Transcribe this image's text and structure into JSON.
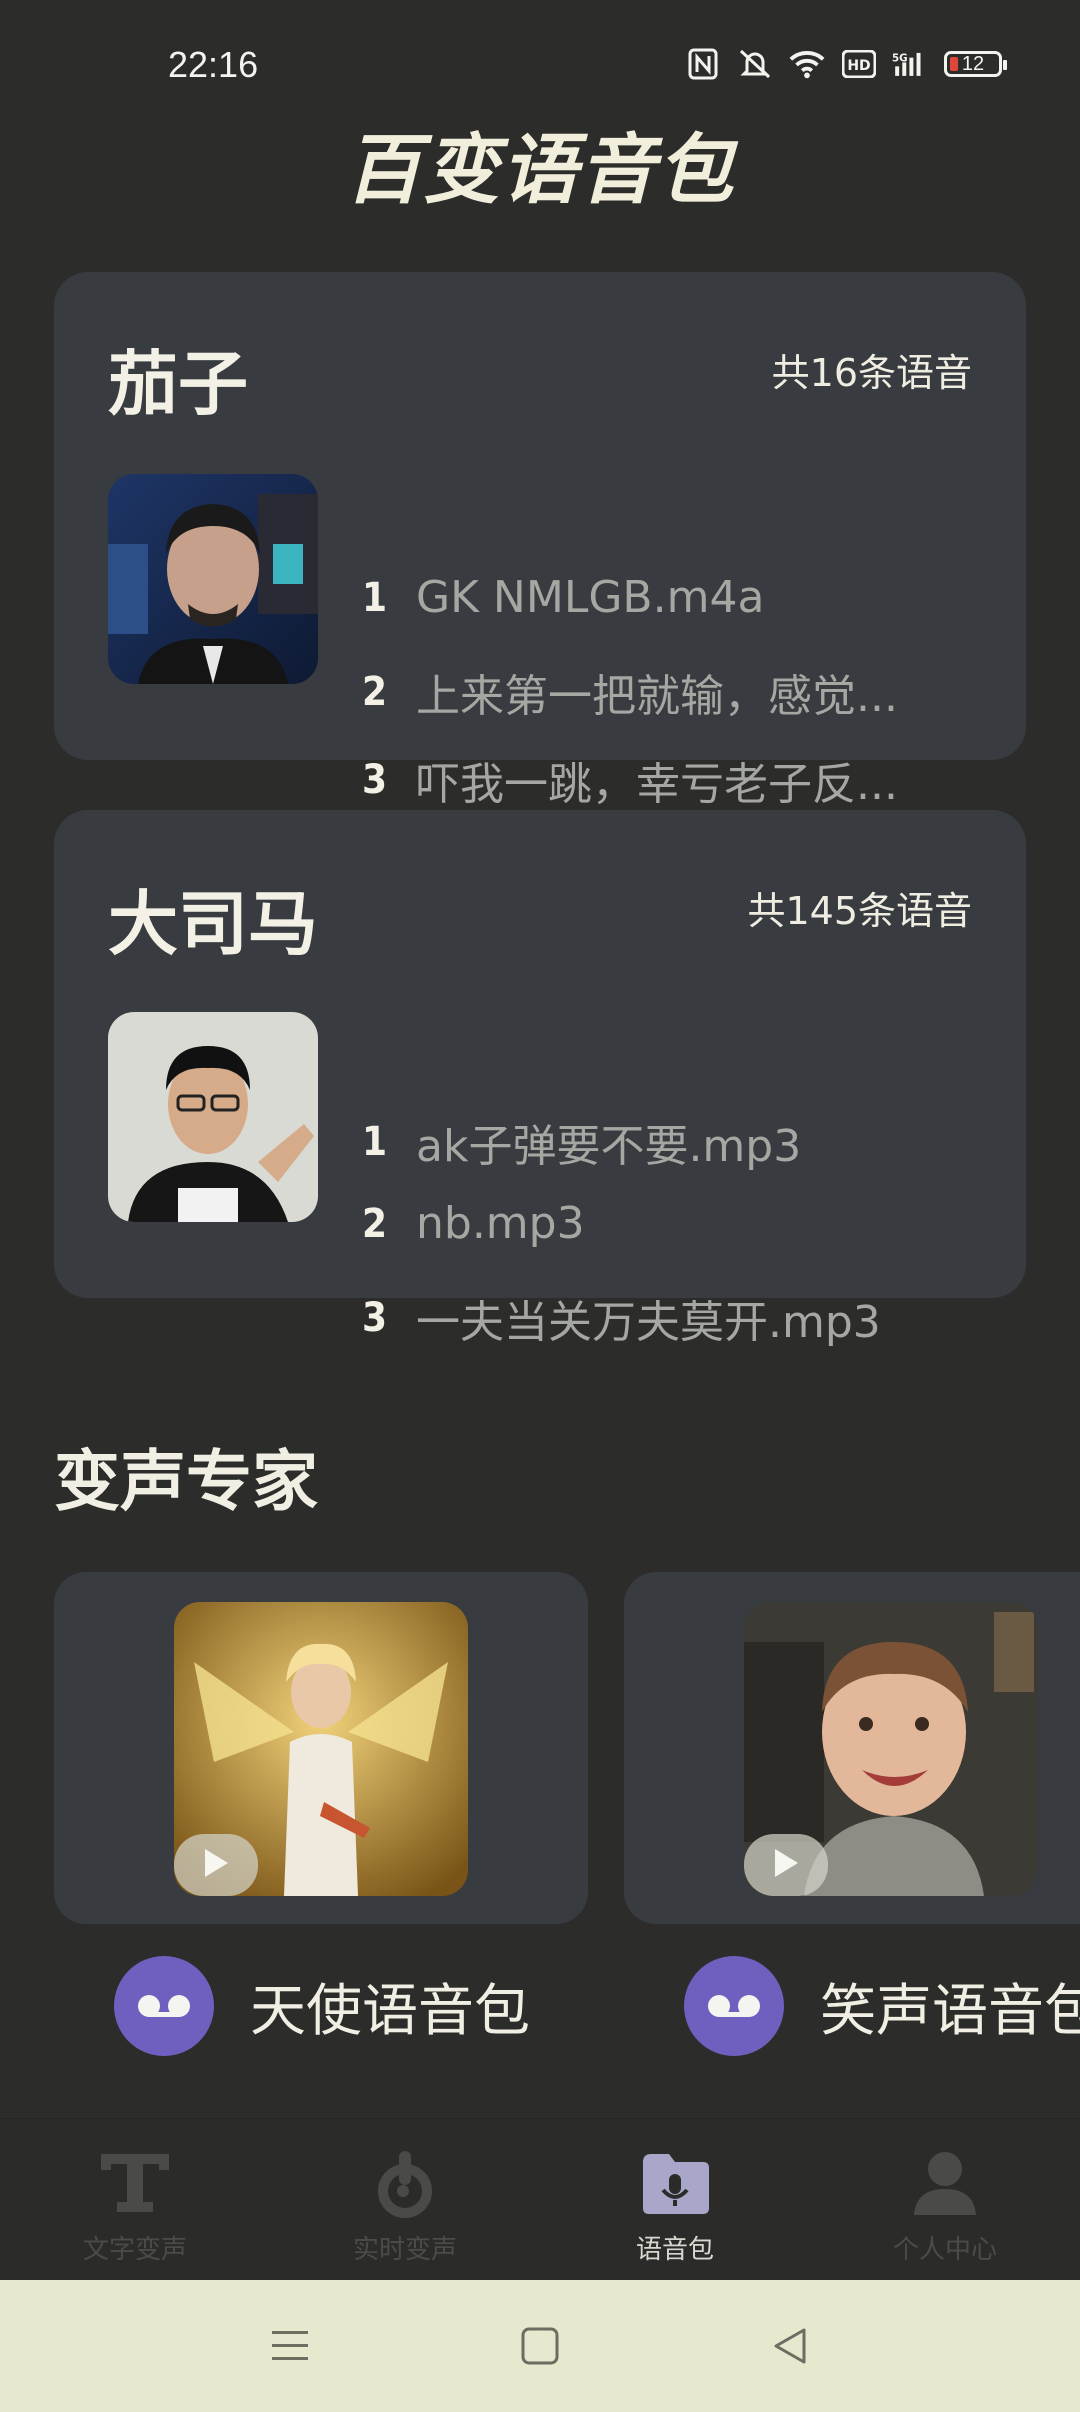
{
  "status_bar": {
    "time": "22:16",
    "icons": [
      "nfc-icon",
      "mute-icon",
      "wifi-icon",
      "hd-icon",
      "5g-signal-icon"
    ],
    "battery": "12"
  },
  "app": {
    "title": "百变语音包"
  },
  "packs": [
    {
      "name": "茄子",
      "count": "共16条语音",
      "tracks": [
        {
          "num": "1",
          "title": "GK  NMLGB.m4a"
        },
        {
          "num": "2",
          "title": "上来第一把就输，感觉..."
        },
        {
          "num": "3",
          "title": "吓我一跳，幸亏老子反..."
        }
      ]
    },
    {
      "name": "大司马",
      "count": "共145条语音",
      "tracks": [
        {
          "num": "1",
          "title": "ak子弹要不要.mp3"
        },
        {
          "num": "2",
          "title": "nb.mp3"
        },
        {
          "num": "3",
          "title": "一夫当关万夫莫开.mp3"
        }
      ]
    }
  ],
  "experts": {
    "title": "变声专家",
    "items": [
      {
        "label": "天使语音包"
      },
      {
        "label": "笑声语音包"
      }
    ]
  },
  "nav": {
    "items": [
      {
        "label": "文字变声",
        "active": false
      },
      {
        "label": "实时变声",
        "active": false
      },
      {
        "label": "语音包",
        "active": true
      },
      {
        "label": "个人中心",
        "active": false
      }
    ]
  },
  "colors": {
    "accent": "#6f5fbf",
    "card": "#383b3f",
    "background": "#2c2d2a"
  }
}
